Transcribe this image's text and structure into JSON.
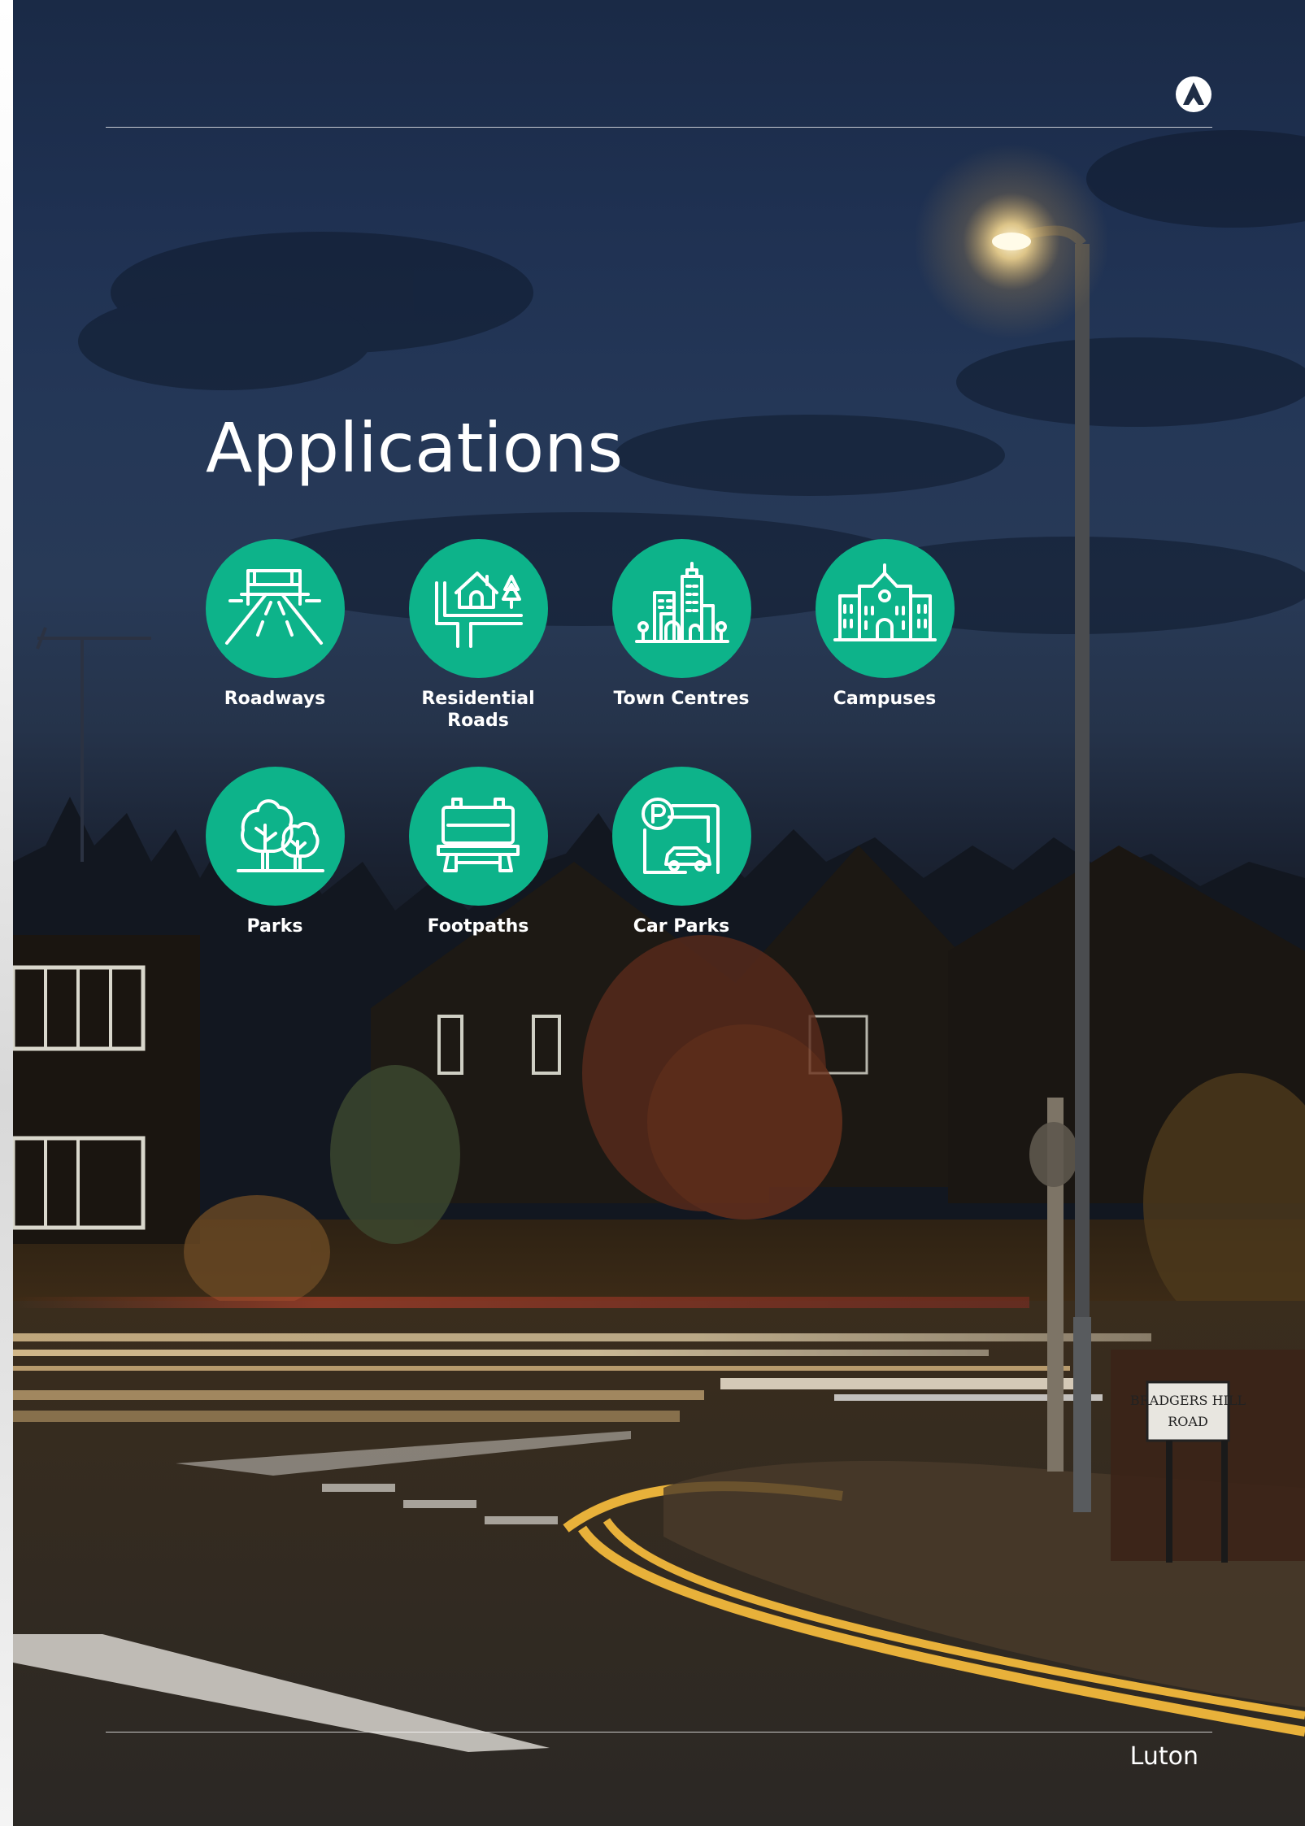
{
  "page": {
    "title": "Applications",
    "location": "Luton"
  },
  "brand": {
    "icon": "brand-logo-icon"
  },
  "colors": {
    "accent": "#0db38a",
    "text": "#ffffff"
  },
  "applications": [
    {
      "label": "Roadways",
      "icon": "roadway-icon"
    },
    {
      "label": "Residential\nRoads",
      "icon": "residential-roads-icon"
    },
    {
      "label": "Town Centres",
      "icon": "town-centres-icon"
    },
    {
      "label": "Campuses",
      "icon": "campuses-icon"
    },
    {
      "label": "Parks",
      "icon": "parks-icon"
    },
    {
      "label": "Footpaths",
      "icon": "footpaths-icon"
    },
    {
      "label": "Car Parks",
      "icon": "car-parks-icon"
    }
  ],
  "scene": {
    "street_sign": "BRADGERS HILL\nROAD"
  }
}
